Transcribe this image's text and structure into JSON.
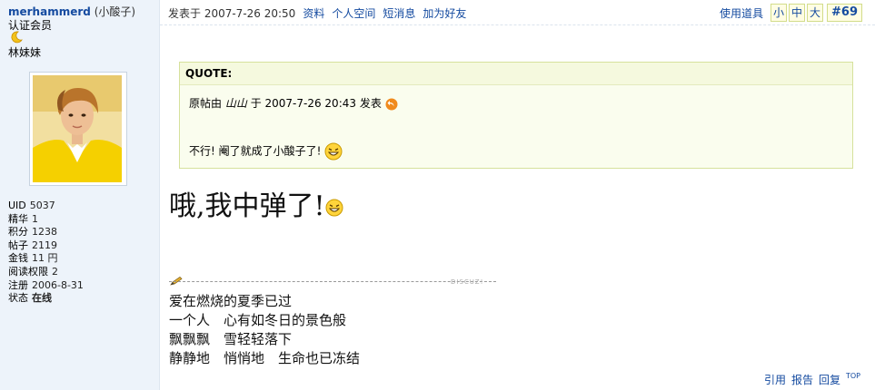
{
  "user": {
    "username": "merhammerd",
    "nickname": "(小酸子)",
    "group": "认证会员",
    "rank": "林妹妹",
    "stats": [
      {
        "key": "UID",
        "value": "5037"
      },
      {
        "key": "精华",
        "value": "1"
      },
      {
        "key": "积分",
        "value": "1238"
      },
      {
        "key": "帖子",
        "value": "2119"
      },
      {
        "key": "金钱",
        "value": "11 円"
      },
      {
        "key": "阅读权限",
        "value": "2"
      },
      {
        "key": "注册",
        "value": "2006-8-31"
      },
      {
        "key": "状态",
        "value": "在线"
      }
    ]
  },
  "header": {
    "posted": "发表于 2007-7-26 20:50",
    "links": [
      "资料",
      "个人空间",
      "短消息",
      "加为好友"
    ],
    "tools": "使用道具",
    "font_sizes": [
      "小",
      "中",
      "大"
    ],
    "post_number": "#69"
  },
  "quote": {
    "title": "QUOTE:",
    "line1_prefix": "原帖由",
    "author": "山山",
    "line1_suffix": "于 2007-7-26 20:43 发表",
    "text": "不行! 阉了就成了小酸子了!"
  },
  "message": "哦,我中弹了!",
  "signature": {
    "watermark": "DISCUZ!",
    "lines": [
      "爱在燃烧的夏季已过",
      "一个人　心有如冬日的景色般",
      "飘飘飘　雪轻轻落下",
      "静静地　悄悄地　生命也已冻结"
    ]
  },
  "actions": {
    "quote": "引用",
    "report": "报告",
    "reply": "回复",
    "top": "TOP"
  }
}
